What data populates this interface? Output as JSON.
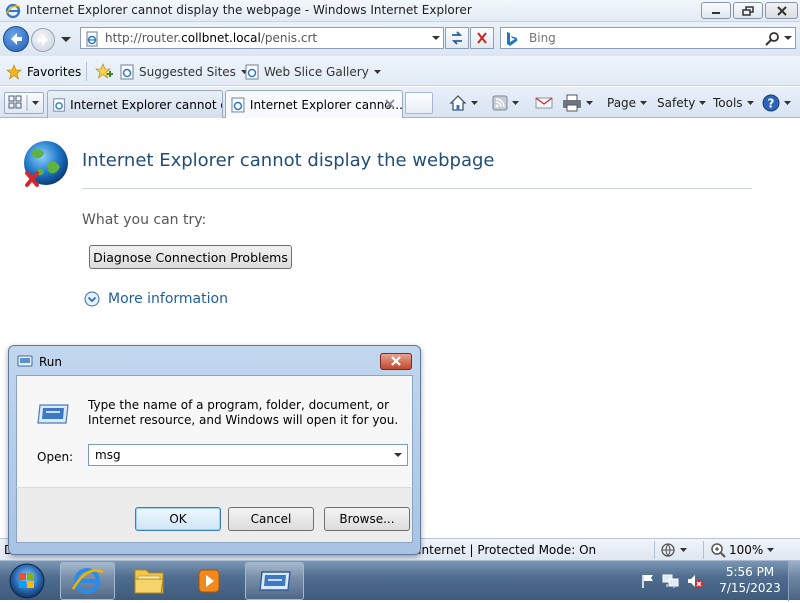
{
  "window": {
    "title": "Internet Explorer cannot display the webpage - Windows Internet Explorer"
  },
  "address": {
    "url_prefix": "http://router.",
    "url_domain": "collbnet.local",
    "url_path": "/penis.crt"
  },
  "search": {
    "placeholder": "Bing"
  },
  "favorites": {
    "label": "Favorites",
    "items": [
      {
        "label": "Suggested Sites"
      },
      {
        "label": "Web Slice Gallery"
      }
    ]
  },
  "tabs": [
    {
      "label": "Internet Explorer cannot di...",
      "active": false
    },
    {
      "label": "Internet Explorer canno...",
      "active": true
    }
  ],
  "commandbar": {
    "page_label": "Page",
    "safety_label": "Safety",
    "tools_label": "Tools"
  },
  "error_page": {
    "title": "Internet Explorer cannot display the webpage",
    "try_label": "What you can try:",
    "diagnose_button": "Diagnose Connection Problems",
    "more_info": "More information"
  },
  "statusbar": {
    "text": "D",
    "zone": "Internet | Protected Mode: On",
    "zoom": "100%"
  },
  "run_dialog": {
    "title": "Run",
    "description": "Type the name of a program, folder, document, or Internet resource, and Windows will open it for you.",
    "open_label": "Open:",
    "open_value": "msg",
    "ok_label": "OK",
    "cancel_label": "Cancel",
    "browse_label": "Browse..."
  },
  "taskbar": {
    "time": "5:56 PM",
    "date": "7/15/2023"
  },
  "colors": {
    "accent": "#1f4e79",
    "link": "#1e5f9a",
    "taskbar": "#4f6d8f"
  }
}
